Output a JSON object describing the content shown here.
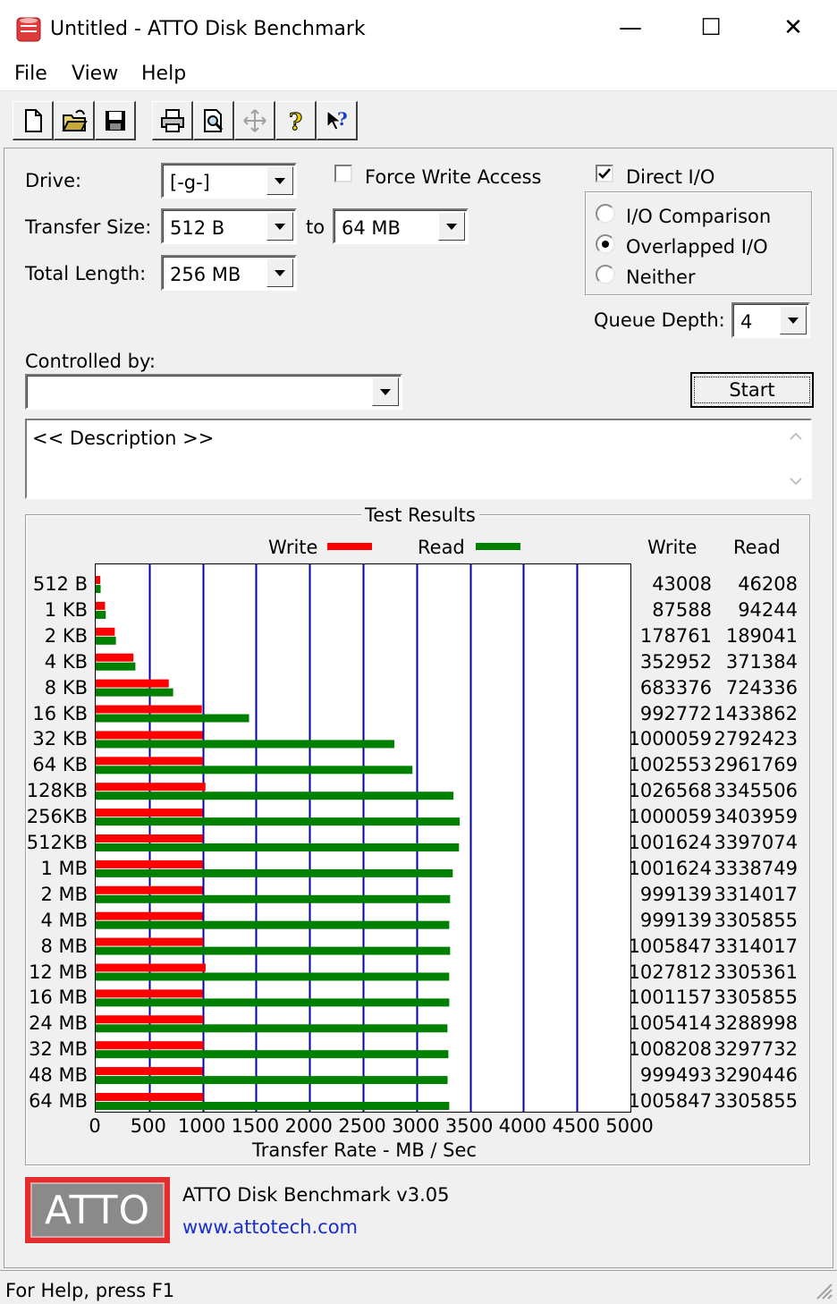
{
  "window": {
    "title": "Untitled - ATTO Disk Benchmark",
    "minimize_glyph": "—",
    "maximize_glyph": "☐",
    "close_glyph": "✕"
  },
  "menu": [
    "File",
    "View",
    "Help"
  ],
  "toolbar": {
    "icons": [
      "new-document-icon",
      "open-folder-icon",
      "save-disk-icon",
      "print-icon",
      "print-preview-icon",
      "move-icon",
      "help-icon",
      "context-help-icon"
    ]
  },
  "form": {
    "drive_label": "Drive:",
    "drive_value": "[-g-]",
    "transfer_label": "Transfer Size:",
    "transfer_from": "512 B",
    "to_label": "to",
    "transfer_to": "64 MB",
    "total_label": "Total Length:",
    "total_value": "256 MB",
    "force_write_label": "Force Write Access",
    "force_write_checked": false,
    "direct_io_label": "Direct I/O",
    "direct_io_checked": true,
    "io_options": [
      {
        "label": "I/O Comparison",
        "selected": false
      },
      {
        "label": "Overlapped I/O",
        "selected": true
      },
      {
        "label": "Neither",
        "selected": false
      }
    ],
    "queue_label": "Queue Depth:",
    "queue_value": "4",
    "controlled_label": "Controlled by:",
    "controlled_value": "",
    "start_label": "Start",
    "description": "<< Description >>"
  },
  "results": {
    "title": "Test Results",
    "legend_write": "Write",
    "legend_read": "Read",
    "col_write": "Write",
    "col_read": "Read",
    "write_color": "#ff0000",
    "read_color": "#008000",
    "grid_color": "#0000aa"
  },
  "chart_data": {
    "type": "bar",
    "orientation": "horizontal",
    "categories": [
      "512 B",
      "1 KB",
      "2 KB",
      "4 KB",
      "8 KB",
      "16 KB",
      "32 KB",
      "64 KB",
      "128KB",
      "256KB",
      "512KB",
      "1 MB",
      "2 MB",
      "4 MB",
      "8 MB",
      "12 MB",
      "16 MB",
      "24 MB",
      "32 MB",
      "48 MB",
      "64 MB"
    ],
    "series": [
      {
        "name": "Write",
        "values": [
          43008,
          87588,
          178761,
          352952,
          683376,
          992772,
          1000059,
          1002553,
          1026568,
          1000059,
          1001624,
          1001624,
          999139,
          999139,
          1005847,
          1027812,
          1001157,
          1005414,
          1008208,
          999493,
          1005847
        ]
      },
      {
        "name": "Read",
        "values": [
          46208,
          94244,
          189041,
          371384,
          724336,
          1433862,
          2792423,
          2961769,
          3345506,
          3403959,
          3397074,
          3338749,
          3314017,
          3305855,
          3314017,
          3305361,
          3305855,
          3288998,
          3297732,
          3290446,
          3305855
        ]
      }
    ],
    "xlabel": "Transfer Rate - MB / Sec",
    "xticks": [
      "0",
      "500",
      "1000",
      "1500",
      "2000",
      "2500",
      "3000",
      "3500",
      "4000",
      "4500",
      "5000"
    ],
    "xlim": [
      0,
      5000
    ],
    "value_unit_divisor": 1000,
    "grid": true
  },
  "footer": {
    "logo_text": "ATTO",
    "version": "ATTO Disk Benchmark v3.05",
    "website": "www.attotech.com",
    "status": "For Help, press F1"
  }
}
